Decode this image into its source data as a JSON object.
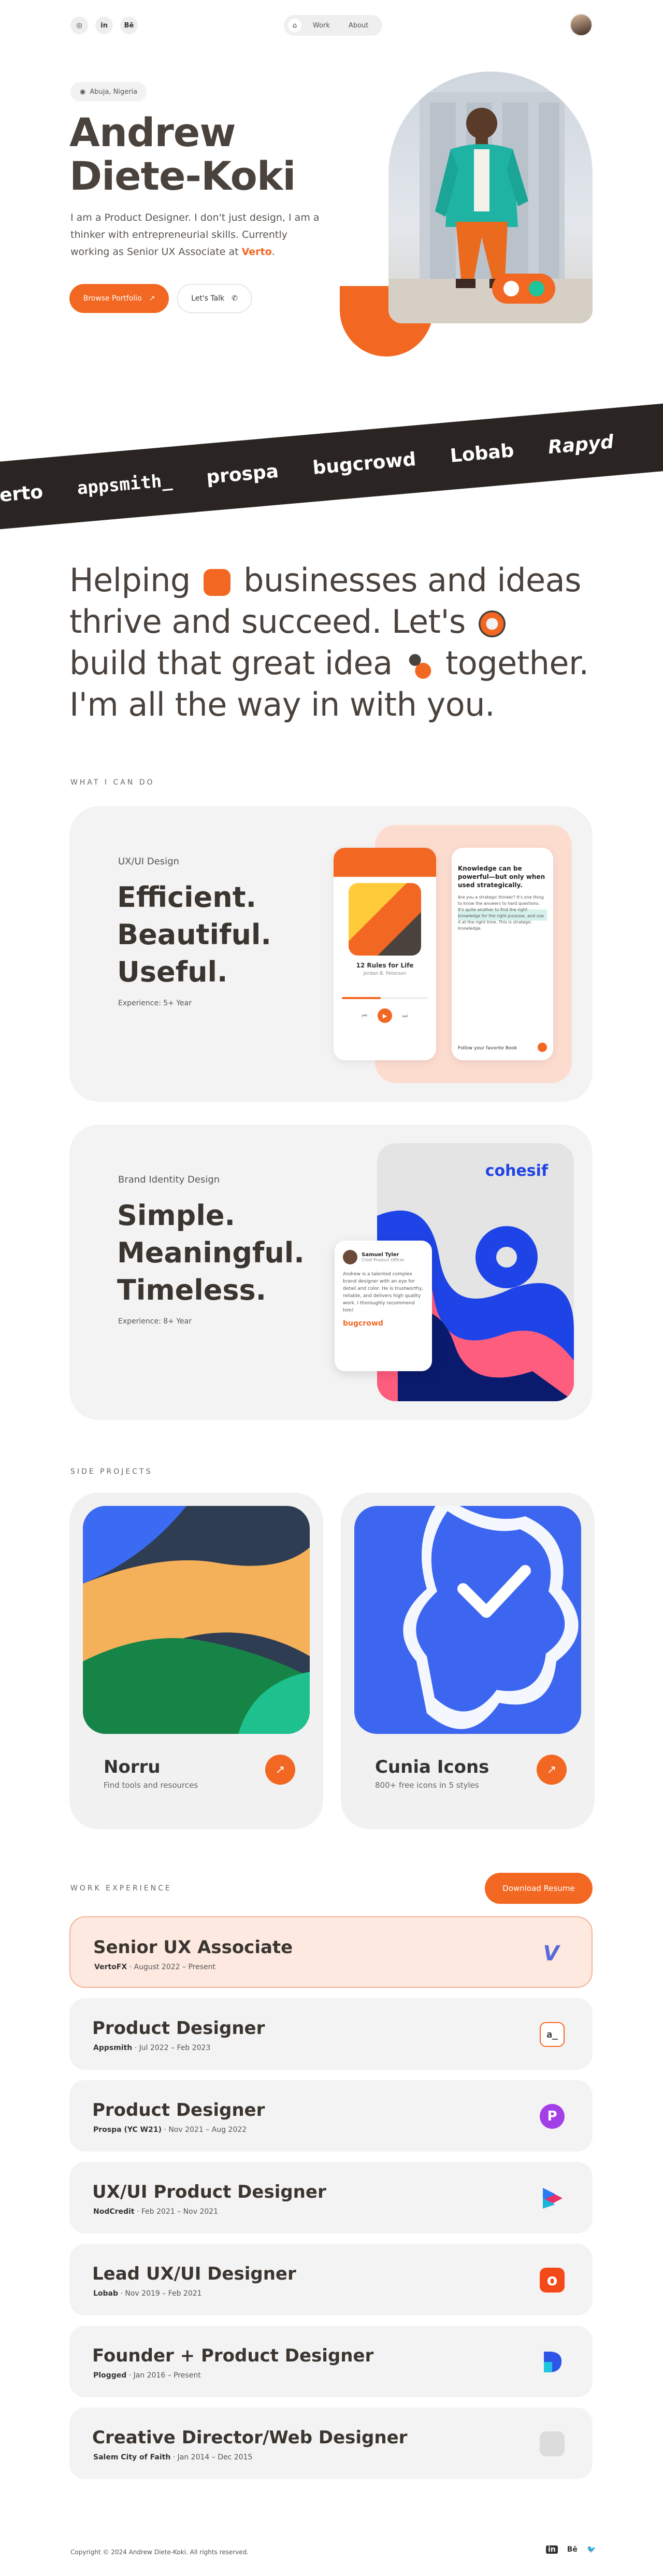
{
  "header": {
    "social": [
      "◎",
      "in",
      "Bē"
    ],
    "nav": {
      "home_icon": "home-icon",
      "work": "Work",
      "about": "About"
    }
  },
  "hero": {
    "location": "Abuja, Nigeria",
    "name_line1": "Andrew",
    "name_line2": "Diete-Koki",
    "intro_pre": "I am a Product Designer. I don't just design, I am a thinker with entrepreneurial skills. Currently working as Senior UX Associate at ",
    "intro_company": "Verto",
    "intro_post": ".",
    "browse_button": "Browse Portfolio",
    "talk_button": "Let's Talk"
  },
  "brands": [
    "verto",
    "appsmith_",
    "prospa",
    "bugcrowd",
    "Lobab",
    "Rapyd"
  ],
  "headline": {
    "p1": "Helping",
    "p2": "businesses and ideas thrive and succeed. Let's",
    "p3": "build that great idea",
    "p4": "together. I'm all the way in with you."
  },
  "services": {
    "eyebrow": "WHAT I CAN DO",
    "items": [
      {
        "label": "UX/UI Design",
        "l1": "Efficient.",
        "l2": "Beautiful.",
        "l3": "Useful.",
        "exp": "Experience: 5+ Year"
      },
      {
        "label": "Brand Identity Design",
        "l1": "Simple.",
        "l2": "Meaningful.",
        "l3": "Timeless.",
        "exp": "Experience: 8+ Year"
      }
    ],
    "mock1": {
      "book_title": "12 Rules for Life",
      "book_author": "Jordan B. Peterson",
      "text_title": "Knowledge can be powerful—but only when used strategically.",
      "body": "Are you a strategic thinker? It's one thing to know the answers to hard questions. It's quite another to find the right knowledge for the right purpose, and use it at the right time. This is strategic knowledge.",
      "footer": "Follow your favorite Book"
    },
    "mock2": {
      "brand": "cohesif",
      "reviewer": "Samuel Tyler",
      "role": "Chief Product Officer",
      "quote": "Andrew is a talented complex brand designer with an eye for detail and color. He is trustworthy, reliable, and delivers high quality work. I thoroughly recommend him!",
      "company": "bugcrowd"
    }
  },
  "projects": {
    "eyebrow": "SIDE PROJECTS",
    "items": [
      {
        "name": "Norru",
        "sub": "Find tools and resources"
      },
      {
        "name": "Cunia Icons",
        "sub": "800+ free icons in 5 styles"
      }
    ]
  },
  "work": {
    "eyebrow": "WORK EXPERIENCE",
    "resume_button": "Download Resume",
    "jobs": [
      {
        "title": "Senior UX Associate",
        "company": "VertoFX",
        "dates": " · August 2022 – Present",
        "logo": "V"
      },
      {
        "title": "Product Designer",
        "company": "Appsmith",
        "dates": " · Jul 2022 – Feb 2023",
        "logo": "a_"
      },
      {
        "title": "Product Designer",
        "company": "Prospa (YC W21)",
        "dates": " · Nov 2021 – Aug 2022",
        "logo": "P"
      },
      {
        "title": "UX/UI Product Designer",
        "company": "NodCredit",
        "dates": " · Feb 2021 – Nov 2021",
        "logo": ""
      },
      {
        "title": "Lead UX/UI Designer",
        "company": "Lobab",
        "dates": " · Nov 2019 – Feb 2021",
        "logo": "o"
      },
      {
        "title": "Founder + Product Designer",
        "company": "Plogged",
        "dates": " · Jan 2016 – Present",
        "logo": ""
      },
      {
        "title": "Creative Director/Web Designer",
        "company": "Salem City of Faith",
        "dates": " · Jan 2014 – Dec 2015",
        "logo": ""
      }
    ]
  },
  "footer": {
    "copyright": "Copyright © 2024 Andrew Diete-Koki. All rights reserved.",
    "icons": [
      "in",
      "Bē",
      "🐦"
    ]
  },
  "colors": {
    "accent": "#f26722",
    "teal": "#1ec59b",
    "dark": "#2a2522"
  }
}
